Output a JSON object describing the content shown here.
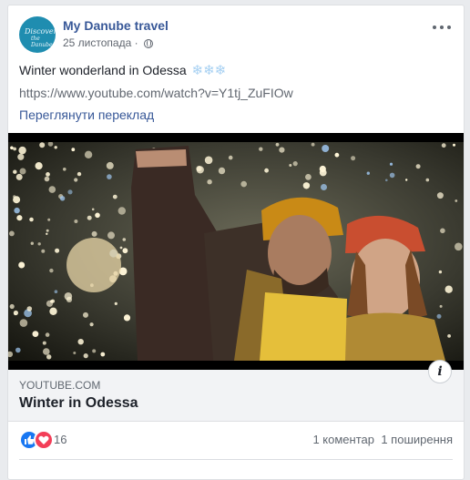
{
  "post": {
    "page_name": "My Danube travel",
    "avatar_text_1": "Discover",
    "avatar_text_2": "the Danube",
    "date": "25 листопада",
    "privacy_icon": "globe-icon",
    "text": "Winter wonderland in Odessa",
    "emoji": "❄❄❄",
    "link": "https://www.youtube.com/watch?v=Y1tj_ZuFIOw",
    "see_translation": "Переглянути переклад"
  },
  "link_preview": {
    "domain": "YOUTUBE.COM",
    "title": "Winter in Odessa",
    "info_label": "i"
  },
  "stats": {
    "reaction_icons": [
      "like-icon",
      "love-icon"
    ],
    "reaction_count": "16",
    "comments": "1 коментар",
    "shares": "1 поширення"
  },
  "colors": {
    "link_blue": "#385898",
    "like": "#1877f2",
    "love": "#f33e58",
    "avatar_bg": "#1f8db0"
  }
}
